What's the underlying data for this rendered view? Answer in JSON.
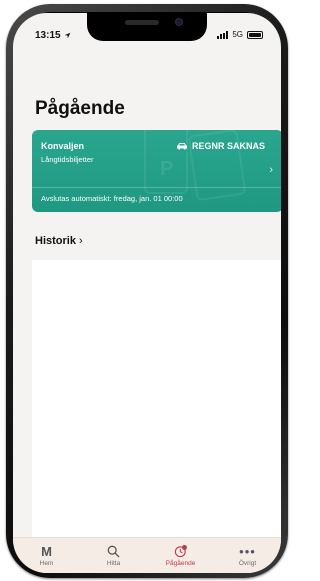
{
  "status_bar": {
    "time": "13:15",
    "network": "5G"
  },
  "page": {
    "title": "Pågående"
  },
  "parking_card": {
    "zone_name": "Konvaljen",
    "plate": "REGNR SAKNAS",
    "ticket_type": "Långtidsbiljetter",
    "end_info": "Avslutas automatiskt: fredag, jan. 01 00:00",
    "color": "#22a08a"
  },
  "history": {
    "label": "Historik"
  },
  "tabbar": {
    "items": [
      {
        "label": "Hem",
        "icon": "logo-m-icon"
      },
      {
        "label": "Hitta",
        "icon": "search-icon"
      },
      {
        "label": "Pågående",
        "icon": "ongoing-clock-icon",
        "active": true
      },
      {
        "label": "Övrigt",
        "icon": "more-icon"
      }
    ],
    "active_color": "#c0394a"
  }
}
